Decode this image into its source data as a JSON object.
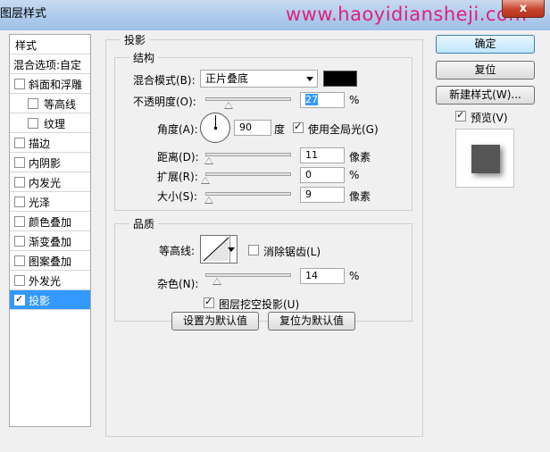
{
  "window": {
    "title": "图层样式",
    "watermark": "www.haoyidiansheji.com",
    "close_label": "x"
  },
  "style_list": {
    "header": "样式",
    "blend_options": "混合选项:自定",
    "items": [
      {
        "label": "斜面和浮雕",
        "checked": false
      },
      {
        "label": "等高线",
        "checked": false
      },
      {
        "label": "纹理",
        "checked": false
      },
      {
        "label": "描边",
        "checked": false
      },
      {
        "label": "内阴影",
        "checked": false
      },
      {
        "label": "内发光",
        "checked": false
      },
      {
        "label": "光泽",
        "checked": false
      },
      {
        "label": "颜色叠加",
        "checked": false
      },
      {
        "label": "渐变叠加",
        "checked": false
      },
      {
        "label": "图案叠加",
        "checked": false
      },
      {
        "label": "外发光",
        "checked": false
      },
      {
        "label": "投影",
        "checked": true
      }
    ]
  },
  "drop_shadow": {
    "title": "投影",
    "structure": {
      "title": "结构",
      "blend_mode_label": "混合模式(B):",
      "blend_mode_value": "正片叠底",
      "shadow_color": "#000000",
      "opacity_label": "不透明度(O):",
      "opacity_value": "27",
      "opacity_unit": "%",
      "opacity_fraction": 0.27,
      "angle_label": "角度(A):",
      "angle_value": "90",
      "angle_unit": "度",
      "global_light_label": "使用全局光(G)",
      "global_light_checked": true,
      "distance_label": "距离(D):",
      "distance_value": "11",
      "distance_unit": "像素",
      "distance_fraction": 0.04,
      "spread_label": "扩展(R):",
      "spread_value": "0",
      "spread_unit": "%",
      "spread_fraction": 0.0,
      "size_label": "大小(S):",
      "size_value": "9",
      "size_unit": "像素",
      "size_fraction": 0.04
    },
    "quality": {
      "title": "品质",
      "contour_label": "等高线:",
      "anti_alias_label": "消除锯齿(L)",
      "anti_alias_checked": false,
      "noise_label": "杂色(N):",
      "noise_value": "14",
      "noise_unit": "%",
      "noise_fraction": 0.14
    },
    "knockout_label": "图层挖空投影(U)",
    "knockout_checked": true,
    "make_default_label": "设置为默认值",
    "reset_default_label": "复位为默认值"
  },
  "buttons": {
    "ok": "确定",
    "reset": "复位",
    "new_style": "新建样式(W)...",
    "preview_label": "预览(V)",
    "preview_checked": true
  }
}
